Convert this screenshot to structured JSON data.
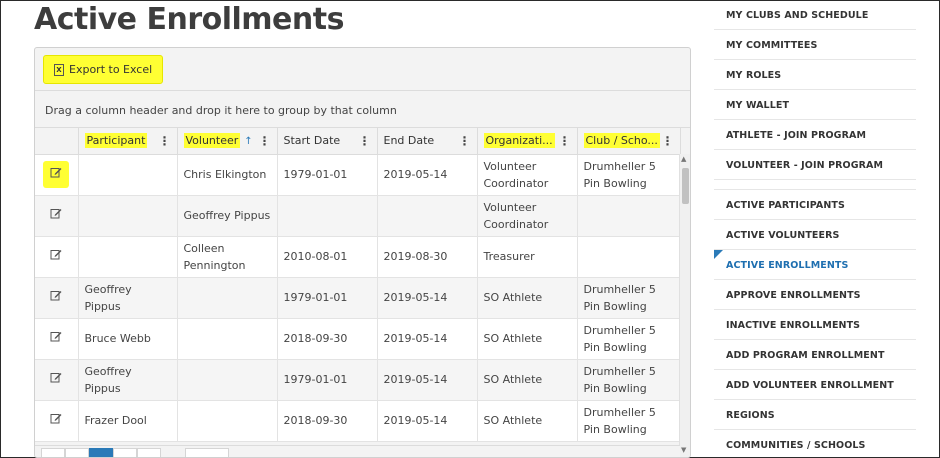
{
  "page": {
    "title": "Active Enrollments"
  },
  "toolbar": {
    "export_label": "Export to Excel",
    "export_icon": "excel-icon",
    "highlight_color": "#ffff33"
  },
  "grouping": {
    "hint": "Drag a column header and drop it here to group by that column"
  },
  "grid": {
    "columns": [
      {
        "label": ""
      },
      {
        "label": "Participant",
        "highlighted": true
      },
      {
        "label": "Volunteer",
        "highlighted": true,
        "sorted": "ascending",
        "sort_icon": "↑"
      },
      {
        "label": "Start Date",
        "highlighted": false
      },
      {
        "label": "End Date",
        "highlighted": false
      },
      {
        "label": "Organizati...",
        "highlighted": true
      },
      {
        "label": "Club / Scho...",
        "highlighted": true
      }
    ],
    "rows": [
      {
        "participant": "",
        "volunteer": "Chris Elkington",
        "start": "1979-01-01",
        "end": "2019-05-14",
        "org": "Volunteer Coordinator",
        "club": "Drumheller 5 Pin Bowling"
      },
      {
        "participant": "",
        "volunteer": "Geoffrey Pippus",
        "start": "",
        "end": "",
        "org": "Volunteer Coordinator",
        "club": ""
      },
      {
        "participant": "",
        "volunteer": "Colleen Pennington",
        "start": "2010-08-01",
        "end": "2019-08-30",
        "org": "Treasurer",
        "club": ""
      },
      {
        "participant": "Geoffrey Pippus",
        "volunteer": "",
        "start": "1979-01-01",
        "end": "2019-05-14",
        "org": "SO Athlete",
        "club": "Drumheller 5 Pin Bowling"
      },
      {
        "participant": "Bruce Webb",
        "volunteer": "",
        "start": "2018-09-30",
        "end": "2019-05-14",
        "org": "SO Athlete",
        "club": "Drumheller 5 Pin Bowling"
      },
      {
        "participant": "Geoffrey Pippus",
        "volunteer": "",
        "start": "1979-01-01",
        "end": "2019-05-14",
        "org": "SO Athlete",
        "club": "Drumheller 5 Pin Bowling"
      },
      {
        "participant": "Frazer Dool",
        "volunteer": "",
        "start": "2018-09-30",
        "end": "2019-05-14",
        "org": "SO Athlete",
        "club": "Drumheller 5 Pin Bowling"
      }
    ]
  },
  "sidebar": {
    "group1": [
      {
        "label": "MY CLUBS AND SCHEDULE"
      },
      {
        "label": "MY COMMITTEES"
      },
      {
        "label": "MY ROLES"
      },
      {
        "label": "MY WALLET"
      },
      {
        "label": "ATHLETE - JOIN PROGRAM"
      },
      {
        "label": "VOLUNTEER - JOIN PROGRAM"
      }
    ],
    "group2": [
      {
        "label": "ACTIVE PARTICIPANTS"
      },
      {
        "label": "ACTIVE VOLUNTEERS"
      },
      {
        "label": "ACTIVE ENROLLMENTS",
        "active": true
      },
      {
        "label": "APPROVE ENROLLMENTS"
      },
      {
        "label": "INACTIVE ENROLLMENTS"
      },
      {
        "label": "ADD PROGRAM ENROLLMENT"
      },
      {
        "label": "ADD VOLUNTEER ENROLLMENT"
      },
      {
        "label": "REGIONS"
      },
      {
        "label": "COMMUNITIES / SCHOOLS"
      }
    ],
    "active_color": "#1e6fb0"
  }
}
